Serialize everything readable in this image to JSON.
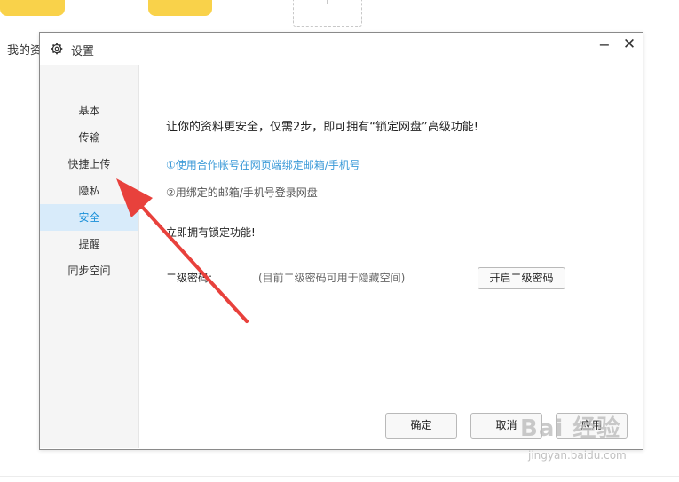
{
  "background": {
    "my_files_text": "我的资"
  },
  "window": {
    "title": "设置",
    "minimize_glyph": "−",
    "close_glyph": "✕"
  },
  "sidebar": {
    "items": [
      {
        "label": "基本",
        "active": false
      },
      {
        "label": "传输",
        "active": false
      },
      {
        "label": "快捷上传",
        "active": false
      },
      {
        "label": "隐私",
        "active": false
      },
      {
        "label": "安全",
        "active": true
      },
      {
        "label": "提醒",
        "active": false
      },
      {
        "label": "同步空间",
        "active": false
      }
    ]
  },
  "security": {
    "headline": "让你的资料更安全，仅需2步，即可拥有“锁定网盘”高级功能!",
    "step1": "①使用合作帐号在网页端绑定邮箱/手机号",
    "step2": "②用绑定的邮箱/手机号登录网盘",
    "own_feature": "立即拥有锁定功能!",
    "password_label": "二级密码:",
    "password_note": "(目前二级密码可用于隐藏空间)",
    "enable_button": "开启二级密码"
  },
  "footer": {
    "ok": "确定",
    "cancel": "取消",
    "apply": "应用"
  },
  "watermark": {
    "brand": "Bai 经验",
    "url": "jingyan.baidu.com"
  },
  "colors": {
    "accent": "#1a90d9",
    "active_bg": "#d8ebfa",
    "arrow": "#e8413c",
    "card": "#f9d24a"
  },
  "icons": {
    "settings": "gear-icon",
    "arrow": "red-pointer-arrow"
  }
}
